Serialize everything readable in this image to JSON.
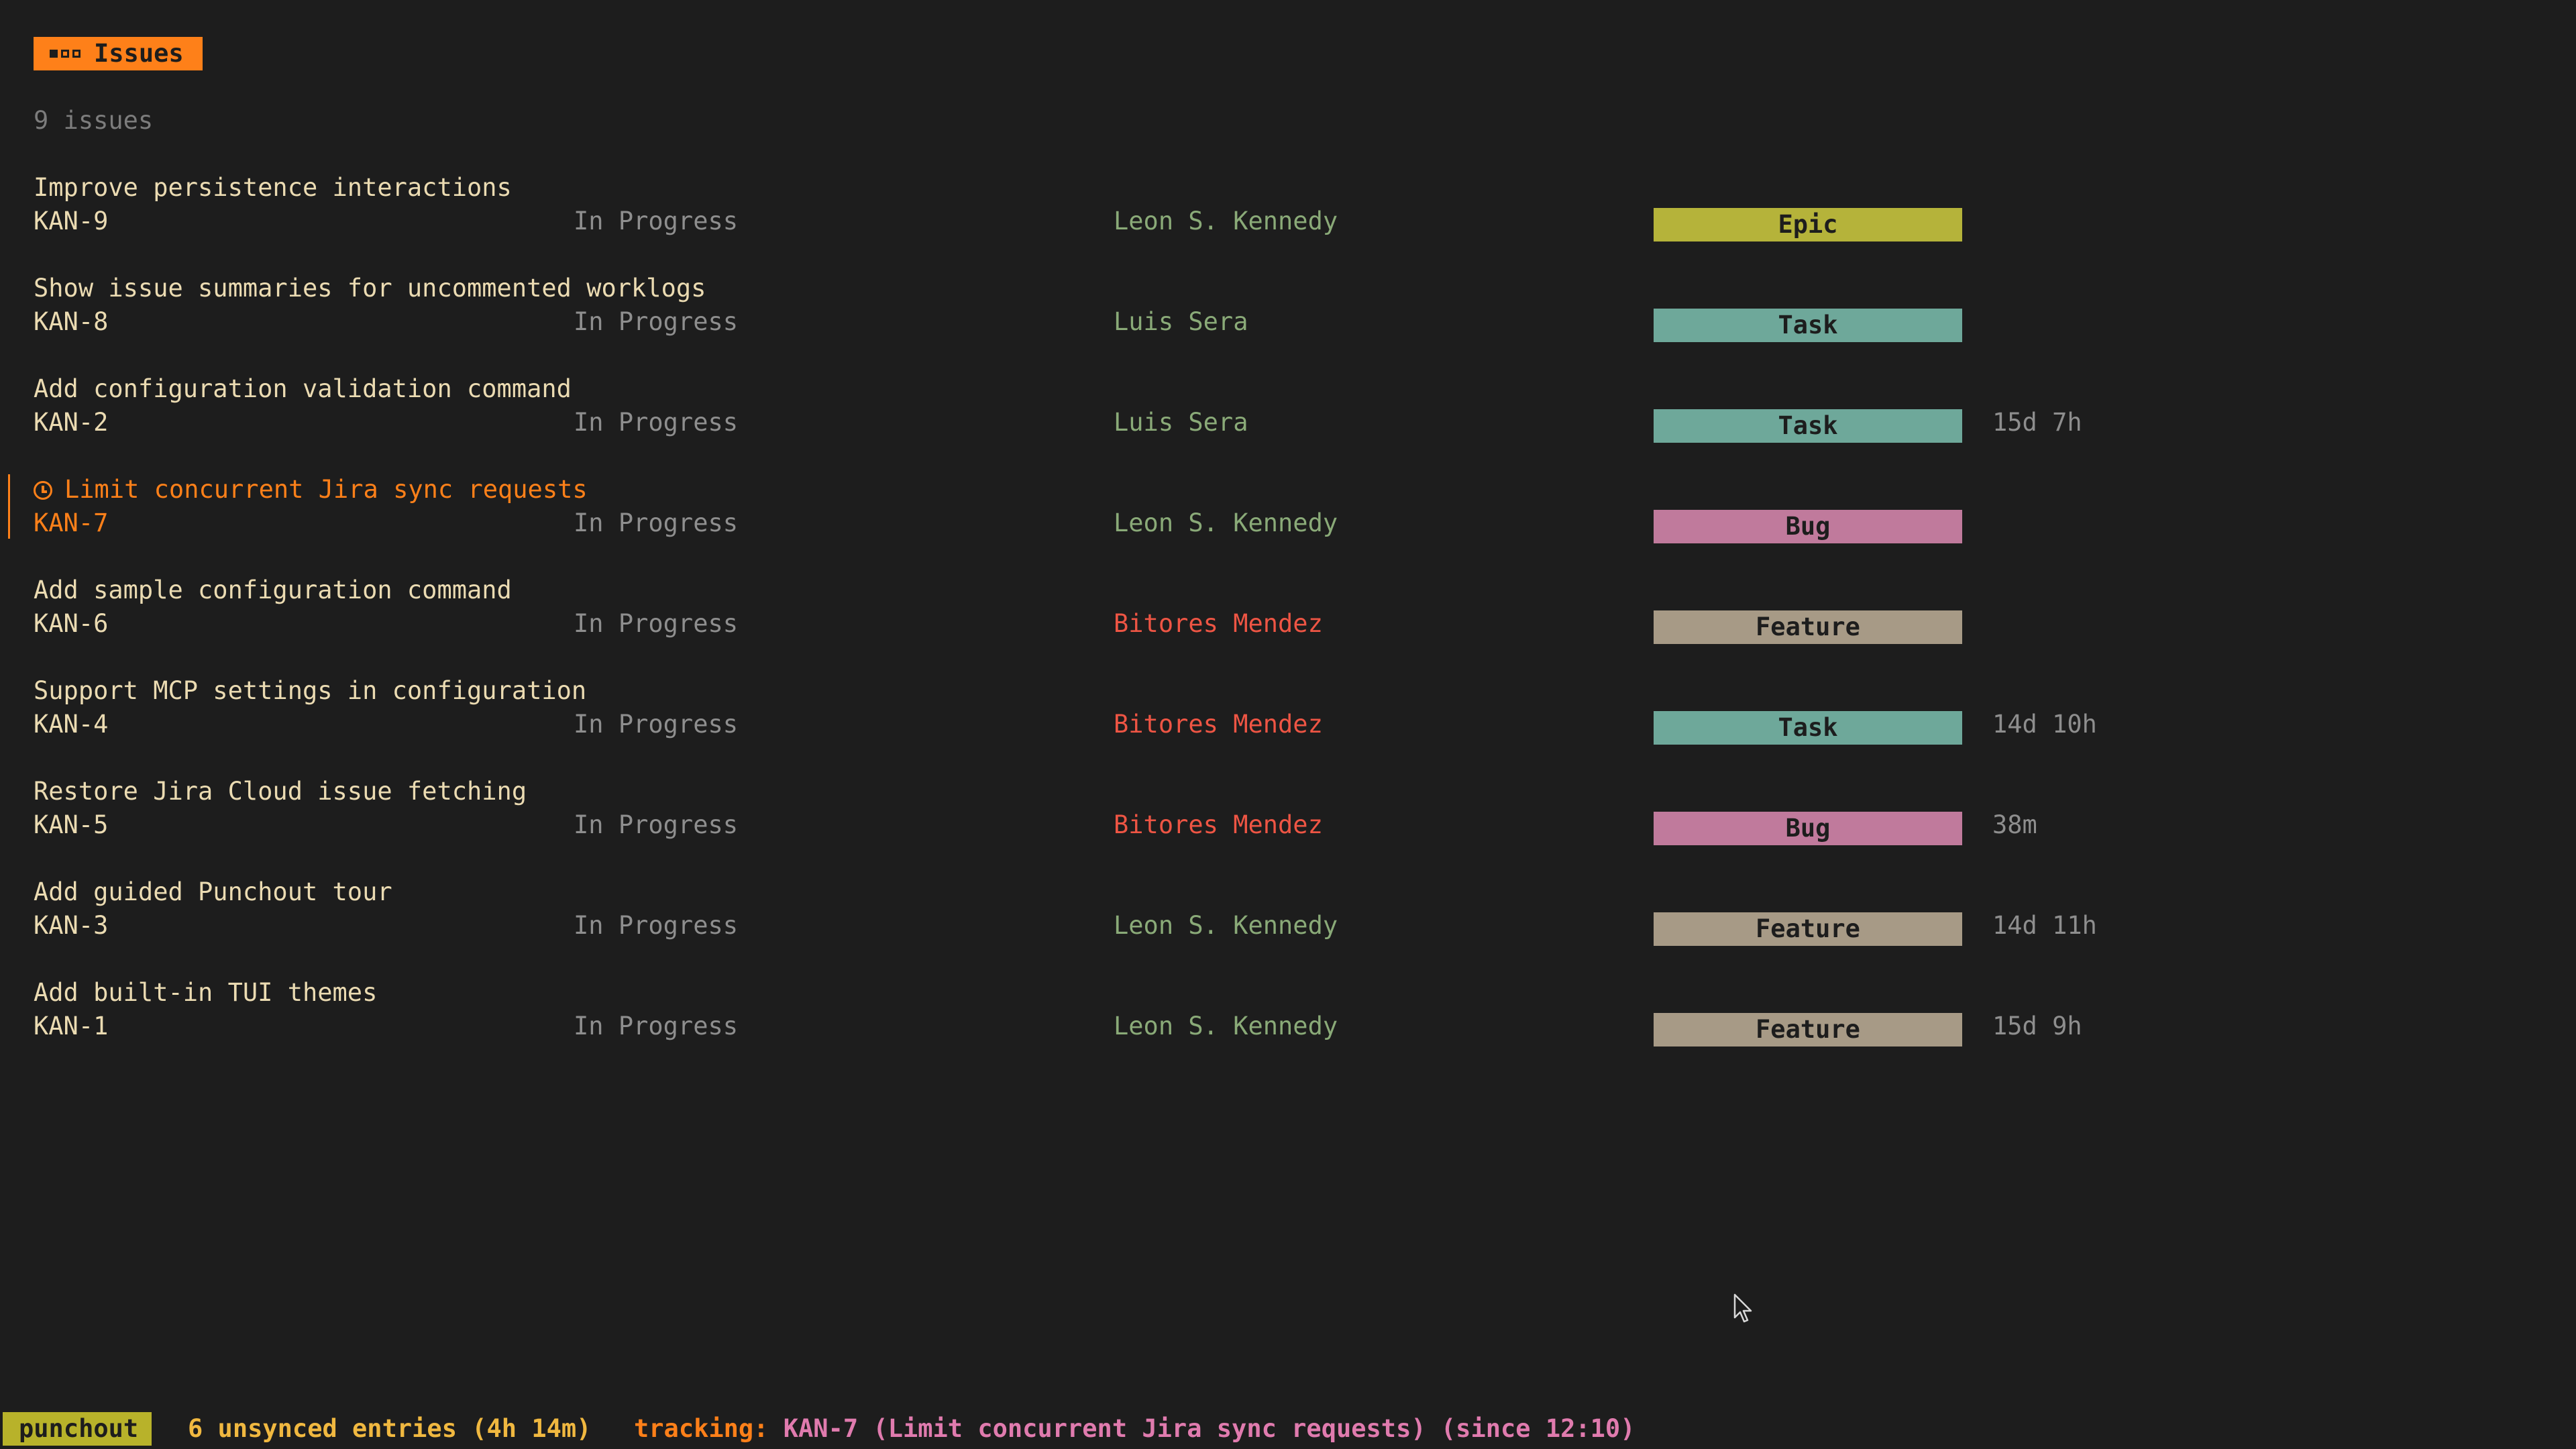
{
  "header": {
    "title": "Issues",
    "icon": "view-menu-icon",
    "accent": "#fe8019"
  },
  "summary": {
    "count_label": "9 issues"
  },
  "issues": [
    {
      "title": "Improve persistence interactions",
      "key": "KAN-9",
      "status": "In Progress",
      "assignee": "Leon S. Kennedy",
      "assignee_color": "#8aaa78",
      "type": "Epic",
      "type_color": "#b5b33a",
      "logged": ""
    },
    {
      "title": "Show issue summaries for uncommented worklogs",
      "key": "KAN-8",
      "status": "In Progress",
      "assignee": "Luis Sera",
      "assignee_color": "#8aaa78",
      "type": "Task",
      "type_color": "#6ea89a",
      "logged": ""
    },
    {
      "title": "Add configuration validation command",
      "key": "KAN-2",
      "status": "In Progress",
      "assignee": "Luis Sera",
      "assignee_color": "#8aaa78",
      "type": "Task",
      "type_color": "#6ea89a",
      "logged": "15d 7h"
    },
    {
      "title": "Limit concurrent Jira sync requests",
      "key": "KAN-7",
      "status": "In Progress",
      "assignee": "Leon S. Kennedy",
      "assignee_color": "#8aaa78",
      "type": "Bug",
      "type_color": "#c07a9c",
      "logged": "",
      "selected": true,
      "tracking_icon": "timer-icon"
    },
    {
      "title": "Add sample configuration command",
      "key": "KAN-6",
      "status": "In Progress",
      "assignee": "Bitores Mendez",
      "assignee_color": "#ee5544",
      "type": "Feature",
      "type_color": "#a79a86",
      "logged": ""
    },
    {
      "title": "Support MCP settings in configuration",
      "key": "KAN-4",
      "status": "In Progress",
      "assignee": "Bitores Mendez",
      "assignee_color": "#ee5544",
      "type": "Task",
      "type_color": "#6ea89a",
      "logged": "14d 10h"
    },
    {
      "title": "Restore Jira Cloud issue fetching",
      "key": "KAN-5",
      "status": "In Progress",
      "assignee": "Bitores Mendez",
      "assignee_color": "#ee5544",
      "type": "Bug",
      "type_color": "#c07a9c",
      "logged": "38m"
    },
    {
      "title": "Add guided Punchout tour",
      "key": "KAN-3",
      "status": "In Progress",
      "assignee": "Leon S. Kennedy",
      "assignee_color": "#8aaa78",
      "type": "Feature",
      "type_color": "#a79a86",
      "logged": "14d 11h"
    },
    {
      "title": "Add built-in TUI themes",
      "key": "KAN-1",
      "status": "In Progress",
      "assignee": "Leon S. Kennedy",
      "assignee_color": "#8aaa78",
      "type": "Feature",
      "type_color": "#a79a86",
      "logged": "15d 9h"
    }
  ],
  "status_bar": {
    "app_name": "punchout",
    "unsynced": "6 unsynced entries (4h 14m)",
    "tracking_label": "tracking:",
    "tracking_detail": " KAN-7 (Limit concurrent Jira sync requests) (since 12:10)",
    "app_color": "#b8b22a"
  },
  "cursor": {
    "icon": "mouse-pointer-icon"
  }
}
